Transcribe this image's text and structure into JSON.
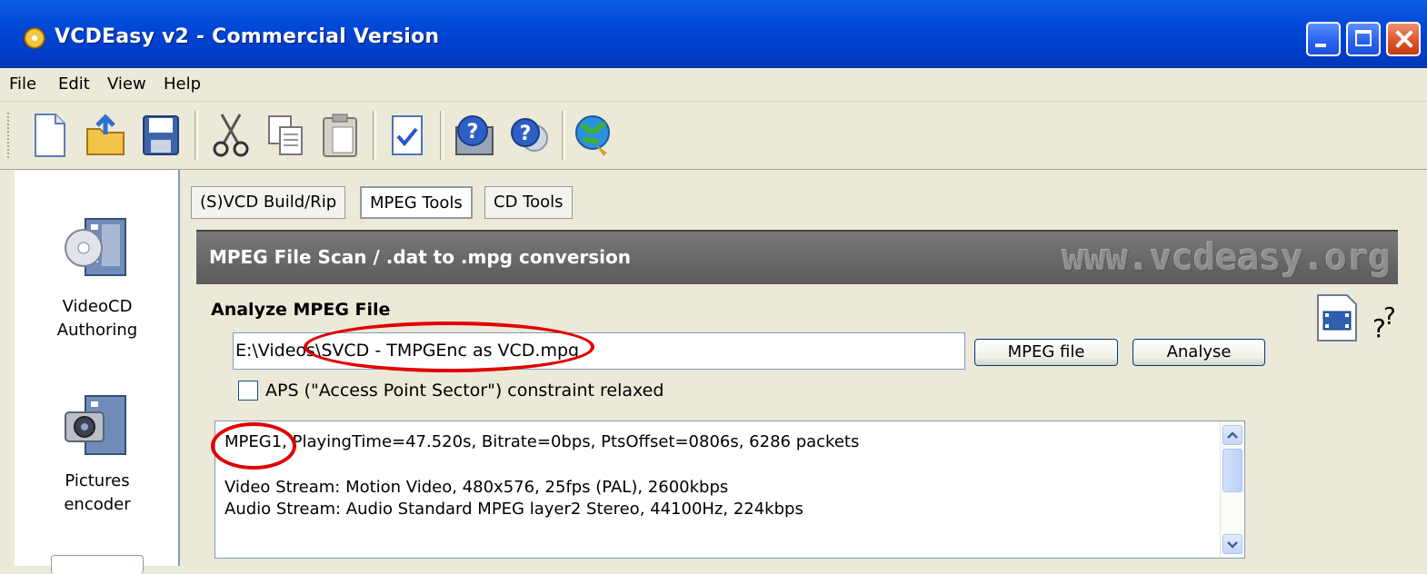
{
  "window": {
    "title": "VCDEasy v2 - Commercial Version"
  },
  "menu": [
    "File",
    "Edit",
    "View",
    "Help"
  ],
  "toolbar": {
    "icons": [
      "new-icon",
      "open-icon",
      "save-icon",
      "cut-icon",
      "copy-icon",
      "paste-icon",
      "check-icon",
      "help-index-icon",
      "help-icon",
      "web-icon"
    ]
  },
  "sidebar": {
    "items": [
      {
        "label": "VideoCD\nAuthoring",
        "icon": "videocd-icon"
      },
      {
        "label": "Pictures\nencoder",
        "icon": "camera-icon"
      }
    ]
  },
  "tabs": [
    {
      "label": "(S)VCD Build/Rip",
      "active": false
    },
    {
      "label": "MPEG Tools",
      "active": true
    },
    {
      "label": "CD Tools",
      "active": false
    }
  ],
  "panel": {
    "header_title": "MPEG File Scan / .dat to .mpg conversion",
    "watermark": "www.vcdeasy.org",
    "section_title": "Analyze MPEG File",
    "file_path": "E:\\Videos\\SVCD - TMPGEnc as VCD.mpg",
    "mpeg_file_button": "MPEG file",
    "analyse_button": "Analyse",
    "aps_label": "APS (\"Access Point Sector\") constraint relaxed",
    "aps_checked": false,
    "output": {
      "line1": "MPEG1, PlayingTime=47.520s, Bitrate=0bps, PtsOffset=0806s, 6286 packets",
      "line2": "Video Stream: Motion Video, 480x576, 25fps (PAL), 2600kbps",
      "line3": "Audio Stream: Audio Standard MPEG layer2 Stereo, 44100Hz, 224kbps"
    }
  },
  "colors": {
    "titlebar": "#0047d8",
    "header": "#666666",
    "highlight": "#e00000"
  }
}
